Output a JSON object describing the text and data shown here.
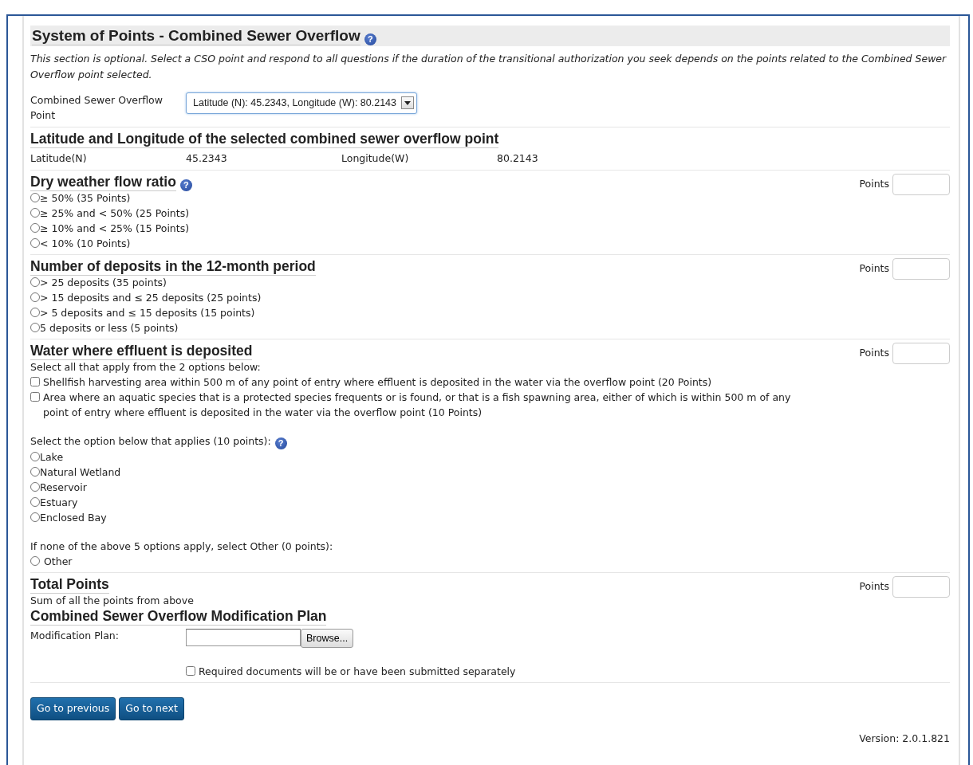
{
  "page": {
    "title": "System of Points - Combined Sewer Overflow",
    "help": "?",
    "intro": "This section is optional. Select a CSO point and respond to all questions if the duration of the transitional authorization you seek depends on the points related to the Combined Sewer Overflow point selected."
  },
  "cso_point": {
    "label": "Combined Sewer Overflow Point",
    "value": "Latitude (N): 45.2343, Longitude (W): 80.2143"
  },
  "coordinates": {
    "heading": "Latitude and Longitude of the selected combined sewer overflow point",
    "fields": [
      {
        "label": "Latitude(N)",
        "value": "45.2343"
      },
      {
        "label": "Longitude(W)",
        "value": "80.2143"
      }
    ]
  },
  "sections": [
    {
      "heading": "Dry weather flow ratio",
      "help": "?",
      "points_label": "Points",
      "groups": [
        {
          "kind": "radio",
          "options": [
            {
              "label": "≥ 50% (35 Points)",
              "checked": false
            },
            {
              "label": "≥ 25% and < 50% (25 Points)",
              "checked": false
            },
            {
              "label": "≥ 10% and < 25% (15 Points)",
              "checked": false
            },
            {
              "label": "< 10% (10 Points)",
              "checked": false
            }
          ]
        }
      ]
    },
    {
      "heading": "Number of deposits in the 12-month period",
      "points_label": "Points",
      "groups": [
        {
          "kind": "radio",
          "options": [
            {
              "label": "> 25 deposits (35 points)",
              "checked": false
            },
            {
              "label": "> 15 deposits and ≤ 25 deposits (25 points)",
              "checked": false
            },
            {
              "label": "> 5 deposits and ≤ 15 deposits (15 points)",
              "checked": false
            },
            {
              "label": "5 deposits or less (5 points)",
              "checked": false
            }
          ]
        }
      ]
    },
    {
      "heading": "Water where effluent is deposited",
      "points_label": "Points",
      "groups": [
        {
          "kind": "checkbox",
          "intro": "Select all that apply from the 2 options below:",
          "options": [
            {
              "label": "Shellfish harvesting area within 500 m of any point of entry where effluent is deposited in the water via the overflow point (20 Points)",
              "checked": false
            },
            {
              "label": "Area where an aquatic species that is a protected species frequents or is found, or that is a fish spawning area, either of which is within 500 m of any point of entry where effluent is deposited in the water via the overflow point (10 Points)",
              "checked": false
            }
          ]
        },
        {
          "kind": "radio",
          "intro": "Select the option below that applies (10 points):",
          "help": "?",
          "options": [
            {
              "label": "Lake",
              "checked": false
            },
            {
              "label": "Natural Wetland",
              "checked": false
            },
            {
              "label": "Reservoir",
              "checked": false
            },
            {
              "label": "Estuary",
              "checked": false
            },
            {
              "label": "Enclosed Bay",
              "checked": false
            }
          ]
        },
        {
          "kind": "radio",
          "intro": "If none of the above 5 options apply, select Other (0 points):",
          "options": [
            {
              "label": "Other",
              "checked": false
            }
          ]
        }
      ]
    }
  ],
  "total": {
    "heading": "Total Points",
    "note": "Sum of all the points from above",
    "points_label": "Points"
  },
  "modification_plan": {
    "heading": "Combined Sewer Overflow Modification Plan",
    "label": "Modification Plan:",
    "browse": "Browse...",
    "confirm": {
      "label": "Required documents will be or have been submitted separately",
      "checked": false
    }
  },
  "buttons": [
    "Go to previous",
    "Go to next"
  ],
  "version": "Version: 2.0.1.821"
}
